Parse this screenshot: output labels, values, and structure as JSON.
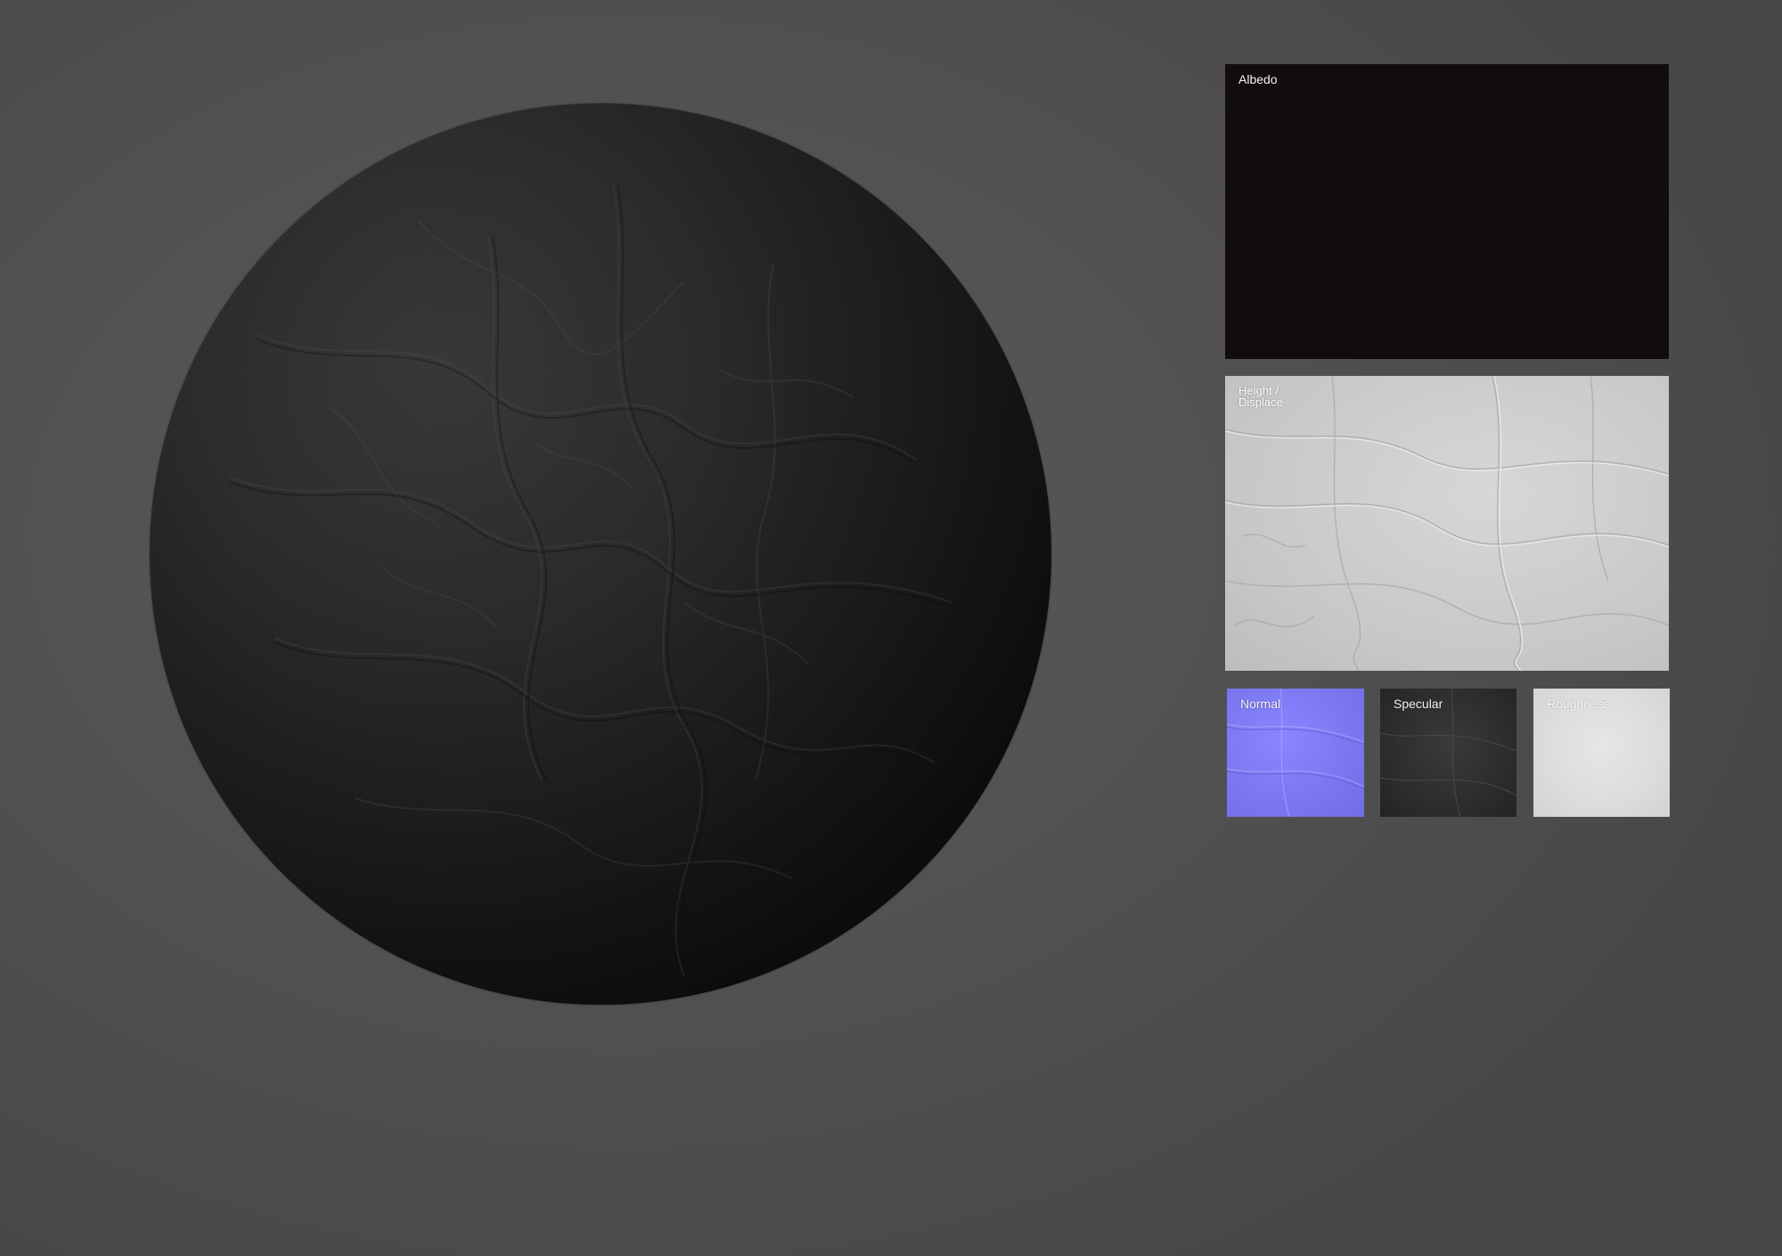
{
  "preview": {
    "sphere_material": "black-leather",
    "background_color": "#555555"
  },
  "maps": {
    "albedo": {
      "label": "Albedo",
      "color": "#120d0c"
    },
    "height": {
      "label": "Height /\nDisplace",
      "color": "#cfcfcf"
    },
    "normal": {
      "label": "Normal",
      "color": "#807cf5"
    },
    "specular": {
      "label": "Specular",
      "color": "#2e2e2e"
    },
    "roughness": {
      "label": "Roughness",
      "color": "#dddddd"
    }
  }
}
